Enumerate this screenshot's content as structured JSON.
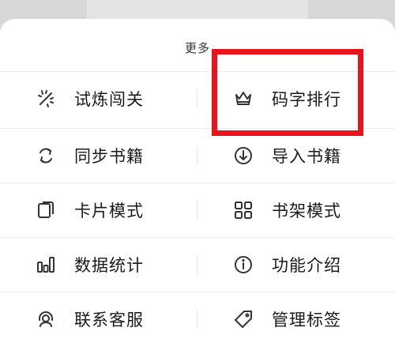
{
  "sheet": {
    "title": "更多"
  },
  "rows": [
    {
      "left": {
        "label": "试炼闯关",
        "icon": "sparkle-icon"
      },
      "right": {
        "label": "码字排行",
        "icon": "crown-icon"
      }
    },
    {
      "left": {
        "label": "同步书籍",
        "icon": "sync-icon"
      },
      "right": {
        "label": "导入书籍",
        "icon": "download-circle-icon"
      }
    },
    {
      "left": {
        "label": "卡片模式",
        "icon": "card-icon"
      },
      "right": {
        "label": "书架模式",
        "icon": "grid-icon"
      }
    },
    {
      "left": {
        "label": "数据统计",
        "icon": "bar-chart-icon"
      },
      "right": {
        "label": "功能介绍",
        "icon": "info-icon"
      }
    },
    {
      "left": {
        "label": "联系客服",
        "icon": "headset-icon"
      },
      "right": {
        "label": "管理标签",
        "icon": "tag-icon"
      }
    }
  ],
  "colors": {
    "highlight": "#e8141b",
    "text": "#1a1a1a",
    "icon": "#333333"
  }
}
